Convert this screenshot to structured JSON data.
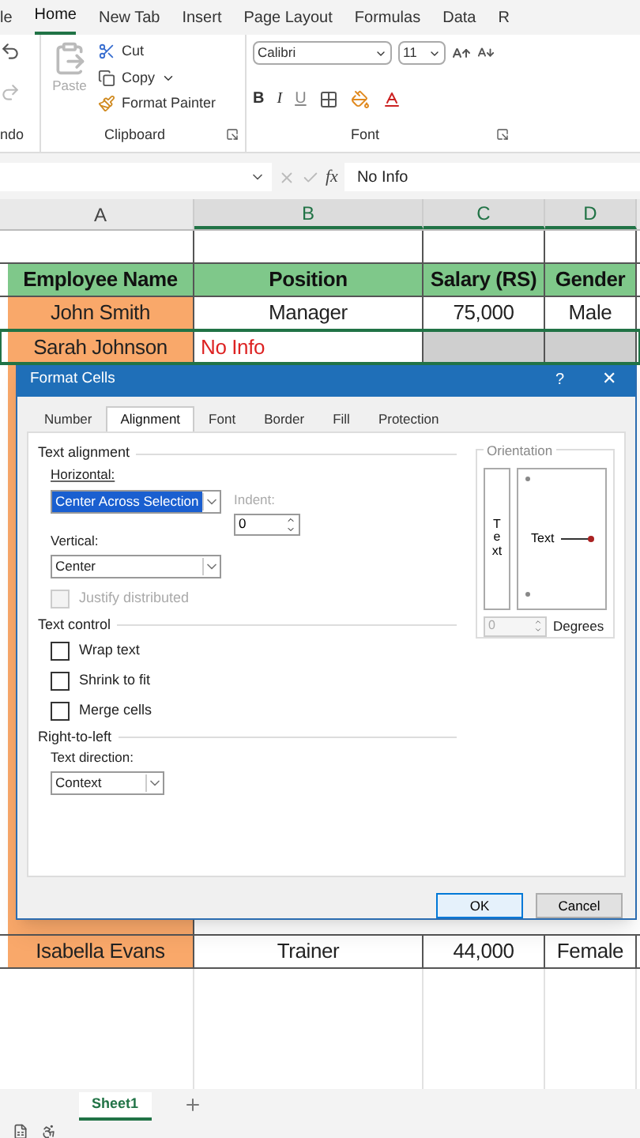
{
  "ribbon_tabs": [
    {
      "label": "le",
      "selected": false
    },
    {
      "label": "Home",
      "selected": true
    },
    {
      "label": "New Tab",
      "selected": false
    },
    {
      "label": "Insert",
      "selected": false
    },
    {
      "label": "Page Layout",
      "selected": false
    },
    {
      "label": "Formulas",
      "selected": false
    },
    {
      "label": "Data",
      "selected": false
    },
    {
      "label": "R",
      "selected": false
    }
  ],
  "ribbon": {
    "undo_group": "ndo",
    "paste": "Paste",
    "cut": "Cut",
    "copy": "Copy",
    "format_painter": "Format Painter",
    "clipboard_group": "Clipboard",
    "font_name": "Calibri",
    "font_size": "11",
    "format_buttons": [
      "B",
      "I",
      "U"
    ],
    "font_group": "Font"
  },
  "formula_bar": {
    "fx": "fx",
    "value": "No Info"
  },
  "sheet": {
    "columns": [
      "A",
      "B",
      "C",
      "D"
    ],
    "rows": [
      {
        "selected": false,
        "cells": [
          {
            "kind": "blank"
          },
          {
            "kind": "blank"
          },
          {
            "kind": "blank"
          },
          {
            "kind": "blank"
          }
        ]
      },
      {
        "selected": false,
        "cells": [
          {
            "kind": "header",
            "text": "Employee Name"
          },
          {
            "kind": "header",
            "text": "Position"
          },
          {
            "kind": "header",
            "text": "Salary (RS)"
          },
          {
            "kind": "header",
            "text": "Gender"
          }
        ]
      },
      {
        "selected": false,
        "cells": [
          {
            "kind": "name",
            "text": "John Smith"
          },
          {
            "kind": "value",
            "text": "Manager"
          },
          {
            "kind": "value",
            "text": "75,000"
          },
          {
            "kind": "value",
            "text": "Male"
          }
        ]
      },
      {
        "selected": true,
        "cells": [
          {
            "kind": "name",
            "text": "Sarah Johnson"
          },
          {
            "kind": "missing",
            "text": "No Info"
          },
          {
            "kind": "value"
          },
          {
            "kind": "value"
          }
        ]
      }
    ],
    "rows_below": [
      {
        "selected": false,
        "cells": [
          {
            "kind": "name",
            "text": "Isabella Evans"
          },
          {
            "kind": "value",
            "text": "Trainer"
          },
          {
            "kind": "value",
            "text": "44,000"
          },
          {
            "kind": "value",
            "text": "Female"
          }
        ]
      }
    ]
  },
  "sheet_tabs": [
    {
      "label": "Sheet1",
      "selected": true
    }
  ],
  "dialog": {
    "title": "Format Cells",
    "help": "?",
    "close": "✕",
    "tabs": [
      {
        "label": "Number",
        "selected": false
      },
      {
        "label": "Alignment",
        "selected": true
      },
      {
        "label": "Font",
        "selected": false
      },
      {
        "label": "Border",
        "selected": false
      },
      {
        "label": "Fill",
        "selected": false
      },
      {
        "label": "Protection",
        "selected": false
      }
    ],
    "text_alignment": {
      "heading": "Text alignment",
      "horizontal_label": "Horizontal:",
      "horizontal_value": "Center Across Selection",
      "indent_label": "Indent:",
      "indent_value": "0",
      "vertical_label": "Vertical:",
      "vertical_value": "Center"
    },
    "justify": {
      "label": "Justify distributed",
      "checked": false,
      "disabled": true
    },
    "text_control": {
      "heading": "Text control",
      "options": [
        {
          "label": "Wrap text",
          "checked": false,
          "disabled": false
        },
        {
          "label": "Shrink to fit",
          "checked": false,
          "disabled": false
        },
        {
          "label": "Merge cells",
          "checked": false,
          "disabled": false
        }
      ]
    },
    "right_to_left": {
      "heading": "Right-to-left",
      "direction_label": "Text direction:",
      "direction_value": "Context"
    },
    "orientation": {
      "heading": "Orientation",
      "vertical_text": "Text",
      "dial_text": "Text",
      "degrees_value": "0",
      "degrees_label": "Degrees"
    },
    "buttons": [
      {
        "label": "OK",
        "kind": "primary"
      },
      {
        "label": "Cancel",
        "kind": "secondary"
      }
    ]
  }
}
